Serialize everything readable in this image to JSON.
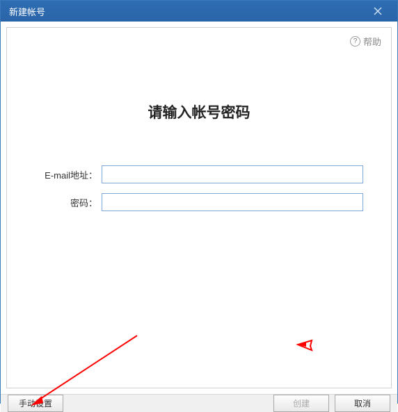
{
  "titlebar": {
    "title": "新建帐号"
  },
  "help": {
    "label": "帮助"
  },
  "main": {
    "heading": "请输入帐号密码"
  },
  "form": {
    "email": {
      "label": "E-mail地址：",
      "value": ""
    },
    "password": {
      "label": "密码：",
      "value": ""
    }
  },
  "footer": {
    "manual": "手动设置",
    "create": "创建",
    "cancel": "取消"
  }
}
